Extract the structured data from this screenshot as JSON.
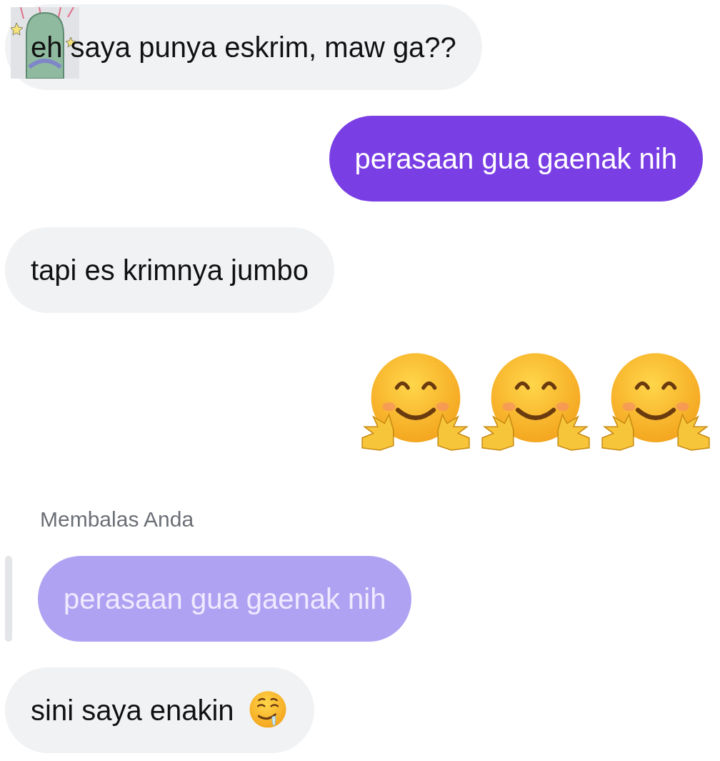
{
  "messages": [
    {
      "kind": "text",
      "sent": false,
      "text": "eh saya punya eskrim, maw ga??",
      "sticker": true
    },
    {
      "kind": "text",
      "sent": true,
      "text": "perasaan gua gaenak nih"
    },
    {
      "kind": "text",
      "sent": false,
      "text": "tapi es krimnya jumbo"
    },
    {
      "kind": "emoji",
      "sent": true,
      "icons": [
        {
          "kind": "hug"
        },
        {
          "kind": "hug"
        },
        {
          "kind": "hug"
        }
      ]
    },
    {
      "kind": "reply",
      "sent": false,
      "label": "Membalas Anda",
      "quote": "perasaan gua gaenak nih"
    },
    {
      "kind": "text",
      "sent": false,
      "text": "sini saya enakin",
      "icons": [
        {
          "kind": "drool"
        }
      ]
    }
  ]
}
